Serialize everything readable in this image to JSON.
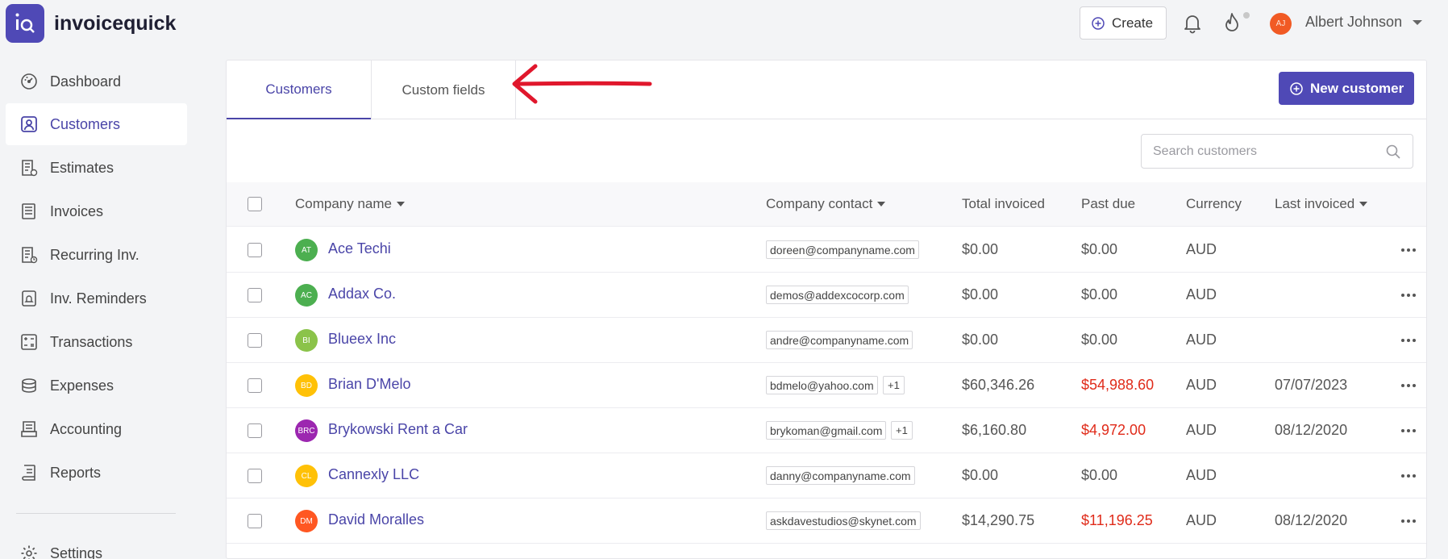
{
  "header": {
    "brand": "invoicequick",
    "create_label": "Create",
    "user_initials": "AJ",
    "user_name": "Albert Johnson"
  },
  "sidebar": {
    "items": [
      {
        "label": "Dashboard",
        "icon": "dashboard-icon"
      },
      {
        "label": "Customers",
        "icon": "customers-icon",
        "active": true
      },
      {
        "label": "Estimates",
        "icon": "estimates-icon"
      },
      {
        "label": "Invoices",
        "icon": "invoices-icon"
      },
      {
        "label": "Recurring Inv.",
        "icon": "recurring-icon"
      },
      {
        "label": "Inv. Reminders",
        "icon": "reminders-icon"
      },
      {
        "label": "Transactions",
        "icon": "transactions-icon"
      },
      {
        "label": "Expenses",
        "icon": "expenses-icon"
      },
      {
        "label": "Accounting",
        "icon": "accounting-icon"
      },
      {
        "label": "Reports",
        "icon": "reports-icon"
      },
      {
        "label": "Settings",
        "icon": "settings-icon"
      }
    ]
  },
  "main": {
    "tabs": [
      {
        "label": "Customers",
        "active": true
      },
      {
        "label": "Custom fields"
      }
    ],
    "new_customer_label": "New customer",
    "search_placeholder": "Search customers",
    "columns": [
      "Company name",
      "Company contact",
      "Total invoiced",
      "Past due",
      "Currency",
      "Last invoiced"
    ],
    "rows": [
      {
        "initials": "AT",
        "color": "#4caf50",
        "name": "Ace Techi",
        "email": "doreen@companyname.com",
        "extra": "",
        "total": "$0.00",
        "past_due": "$0.00",
        "past_due_red": false,
        "currency": "AUD",
        "last": ""
      },
      {
        "initials": "AC",
        "color": "#4caf50",
        "name": "Addax Co.",
        "email": "demos@addexcocorp.com",
        "extra": "",
        "total": "$0.00",
        "past_due": "$0.00",
        "past_due_red": false,
        "currency": "AUD",
        "last": ""
      },
      {
        "initials": "BI",
        "color": "#8bc34a",
        "name": "Blueex Inc",
        "email": "andre@companyname.com",
        "extra": "",
        "total": "$0.00",
        "past_due": "$0.00",
        "past_due_red": false,
        "currency": "AUD",
        "last": ""
      },
      {
        "initials": "BD",
        "color": "#ffc107",
        "name": "Brian D'Melo",
        "email": "bdmelo@yahoo.com",
        "extra": "+1",
        "total": "$60,346.26",
        "past_due": "$54,988.60",
        "past_due_red": true,
        "currency": "AUD",
        "last": "07/07/2023"
      },
      {
        "initials": "BRC",
        "color": "#9c27b0",
        "name": "Brykowski Rent a Car",
        "email": "brykoman@gmail.com",
        "extra": "+1",
        "total": "$6,160.80",
        "past_due": "$4,972.00",
        "past_due_red": true,
        "currency": "AUD",
        "last": "08/12/2020"
      },
      {
        "initials": "CL",
        "color": "#ffc107",
        "name": "Cannexly LLC",
        "email": "danny@companyname.com",
        "extra": "",
        "total": "$0.00",
        "past_due": "$0.00",
        "past_due_red": false,
        "currency": "AUD",
        "last": ""
      },
      {
        "initials": "DM",
        "color": "#ff5722",
        "name": "David Moralles",
        "email": "askdavestudios@skynet.com",
        "extra": "",
        "total": "$14,290.75",
        "past_due": "$11,196.25",
        "past_due_red": true,
        "currency": "AUD",
        "last": "08/12/2020"
      }
    ]
  },
  "colors": {
    "accent": "#4f49b6",
    "past_due": "#e02b1a",
    "annotation_arrow": "#e0172c"
  }
}
